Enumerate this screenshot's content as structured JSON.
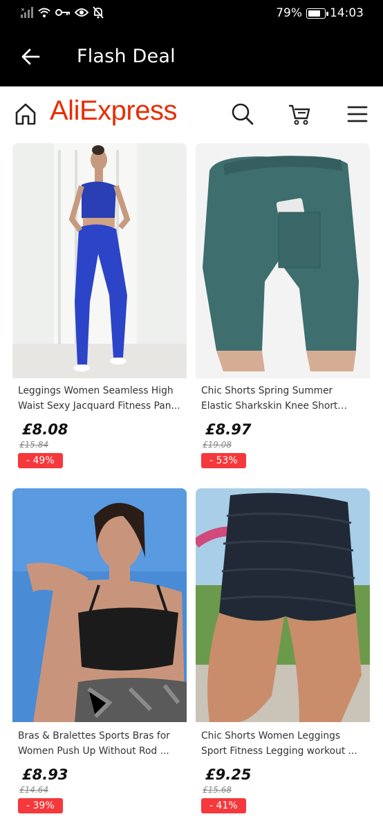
{
  "status_bar": {
    "battery": "79%",
    "battery_level": 0.79,
    "time": "14:03",
    "icons": [
      "signal-icon",
      "wifi-icon",
      "key-icon",
      "eye-icon",
      "bell-off-icon",
      "battery-icon"
    ]
  },
  "header": {
    "title": "Flash Deal",
    "back_icon": "back-arrow-icon"
  },
  "ali_header": {
    "logo": "AliExpress",
    "logo_color": "#e62e04",
    "icons": [
      "home-icon",
      "search-icon",
      "cart-icon",
      "menu-icon"
    ]
  },
  "colors": {
    "discount_bg": "#f5383b",
    "header_bg": "#000000"
  },
  "products": [
    {
      "title": "Leggings Women Seamless High Waist Sexy Jacquard Fitness Pan...",
      "price": "£8.08",
      "original_price": "£15.84",
      "discount": "- 49%"
    },
    {
      "title": "Chic Shorts Spring Summer Elastic Sharkskin Knee Short Biker Shor...",
      "price": "£8.97",
      "original_price": "£19.08",
      "discount": "- 53%"
    },
    {
      "title": "Bras & Bralettes Sports Bras for Women Push Up Without Rod ...",
      "price": "£8.93",
      "original_price": "£14.64",
      "discount": "- 39%"
    },
    {
      "title": "Chic Shorts Women Leggings Sport Fitness Legging workout ...",
      "price": "£9.25",
      "original_price": "£15.68",
      "discount": "- 41%"
    }
  ]
}
